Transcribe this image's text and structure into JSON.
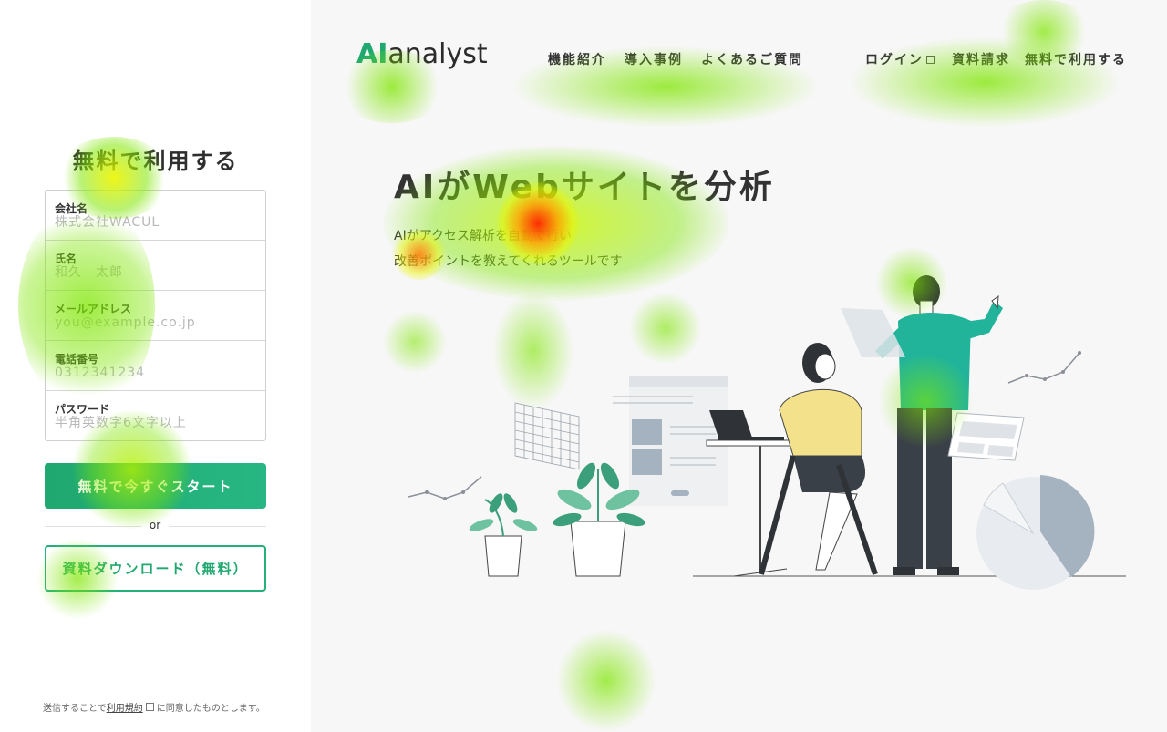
{
  "form": {
    "title": "無料で利用する",
    "fields": [
      {
        "label": "会社名",
        "placeholder": "株式会社WACUL"
      },
      {
        "label": "氏名",
        "placeholder": "和久　太郎"
      },
      {
        "label": "メールアドレス",
        "placeholder": "you@example.co.jp"
      },
      {
        "label": "電話番号",
        "placeholder": "0312341234"
      },
      {
        "label": "パスワード",
        "placeholder": "半角英数字6文字以上"
      }
    ],
    "start_button": "無料で今すぐスタート",
    "or": "or",
    "download_button": "資料ダウンロード（無料）",
    "terms_prefix": "送信することで",
    "terms_link": "利用規約",
    "terms_suffix": "に同意したものとします。"
  },
  "header": {
    "logo_ai": "AI",
    "logo_rest": "analyst",
    "nav_features": "機能紹介",
    "nav_cases": "導入事例",
    "nav_faq": "よくあるご質問",
    "nav_login": "ログイン",
    "nav_request": "資料請求",
    "nav_free": "無料で利用する"
  },
  "hero": {
    "title": "AIがWebサイトを分析",
    "subtitle_line1": "AIがアクセス解析を自動で行い",
    "subtitle_line2": "改善ポイントを教えてくれるツールです"
  },
  "colors": {
    "brand_green": "#1fa86f",
    "heat_low": "#7ee600",
    "heat_high": "#ff2200"
  }
}
